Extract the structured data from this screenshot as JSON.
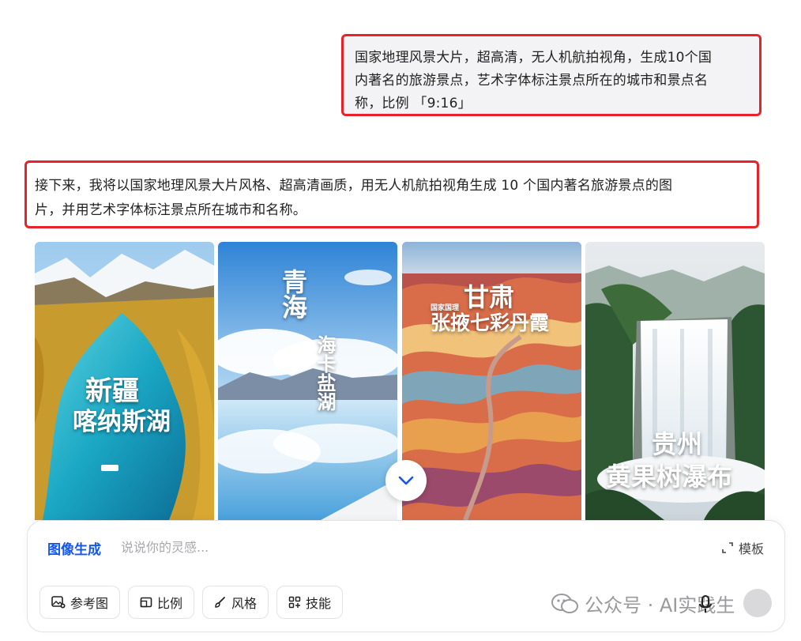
{
  "conversation": {
    "user_prompt_lines": [
      "国家地理风景大片，超高清，无人机航拍视角，生成10个国",
      "内著名的旅游景点，艺术字体标注景点所在的城市和景点名",
      "称，比例 「9:16」"
    ],
    "reply_lines": [
      "接下来，我将以国家地理风景大片风格、超高清画质，用无人机航拍视角生成 10 个国内著名旅游景点的图",
      "片，并用艺术字体标注景点所在城市和名称。"
    ]
  },
  "gallery": {
    "images": [
      {
        "caption_line1": "新疆",
        "caption_line2": "喀纳斯湖"
      },
      {
        "caption_line1": "青海",
        "caption_line2": "海卡盐湖"
      },
      {
        "caption_small": "国家国理",
        "caption_line1": "甘肃",
        "caption_line2": "张掖七彩丹霞"
      },
      {
        "caption_line1": "贵州",
        "caption_line2": "黄果树瀑布"
      }
    ]
  },
  "composer": {
    "mode_label": "图像生成",
    "placeholder": "说说你的灵感...",
    "template_label": "模板",
    "tools": {
      "reference": "参考图",
      "ratio": "比例",
      "style": "风格",
      "skill": "技能"
    }
  },
  "watermark": {
    "text": "公众号 · AI实践生"
  },
  "colors": {
    "highlight_border": "#e8222a",
    "accent": "#1456f0"
  }
}
